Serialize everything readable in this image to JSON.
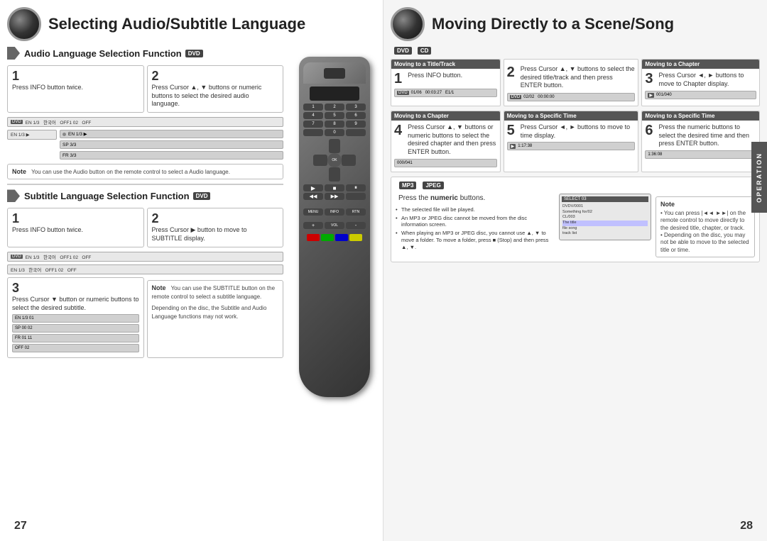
{
  "left": {
    "title": "Selecting Audio/Subtitle Language",
    "audio_section": {
      "label": "Audio Language Selection Function",
      "badge": "DVD",
      "step1": {
        "num": "1",
        "text": "Press INFO button twice."
      },
      "step2": {
        "num": "2",
        "text": "Press Cursor ▲, ▼ buttons or numeric buttons to select the desired audio language."
      },
      "note": "You can use the Audio button on the remote control to select a Audio language.",
      "screens": {
        "row1": "DVD  EN 1/3  한국어  OFF1 02  OFF",
        "row2a": "EN 1/3 ▶",
        "row2b": "SP 3/3",
        "row2c": "FR 3/3"
      }
    },
    "subtitle_section": {
      "label": "Subtitle Language Selection Function",
      "badge": "DVD",
      "step1": {
        "num": "1",
        "text": "Press INFO button twice."
      },
      "step2": {
        "num": "2",
        "text": "Press Cursor ▶ button to move to SUBTITLE display."
      },
      "step3": {
        "num": "3",
        "text": "Press Cursor ▼ button or numeric buttons to select the desired subtitle."
      },
      "note1": "You can use the SUBTITLE button on the remote control to select a subtitle language.",
      "note2": "Depending on the disc, the Subtitle and Audio Language functions may not work.",
      "screens": {
        "row1": "DVD  EN 1/3  한국어  OFF1 02  OFF",
        "row2": "EN 1/3  한국어  OFF1 02  OFF",
        "row3a": "EN 1/3  01",
        "row3b": "SP 00 02",
        "row3c": "FR 01 11",
        "row3d": "OFF  02"
      }
    }
  },
  "right": {
    "title": "Moving Directly to a Scene/Song",
    "badges": [
      "DVD",
      "CD"
    ],
    "section_title_track": "Moving to a Title/Track",
    "section_title_chapter": "Moving to a Chapter",
    "step1": {
      "num": "1",
      "text": "Press INFO button."
    },
    "step2": {
      "num": "2",
      "text": "Press Cursor ▲, ▼ buttons to select the desired title/track and then press ENTER button."
    },
    "step3": {
      "num": "3",
      "text": "Press Cursor ◄, ► buttons to move to Chapter display."
    },
    "section_chapter2": "Moving to a Chapter",
    "section_specific1": "Moving to a Specific Time",
    "section_specific2": "Moving to a Specific Time",
    "step4": {
      "num": "4",
      "text": "Press Cursor ▲, ▼ buttons or numeric buttons to select the desired chapter and then press ENTER button."
    },
    "step5": {
      "num": "5",
      "text": "Press Cursor ◄, ► buttons to move to time display."
    },
    "step6": {
      "num": "6",
      "text": "Press the numeric buttons to select the desired time and then press ENTER button."
    },
    "mp3_badges": [
      "MP3",
      "JPEG"
    ],
    "mp3_step": {
      "text": "Press the numeric buttons."
    },
    "bullet1": "The selected file will be played.",
    "bullet2": "An MP3 or JPEG disc cannot be moved from the disc information screen.",
    "bullet3": "When playing an MP3 or JPEG disc, you cannot use ▲, ▼ to move a folder. To move a folder, press ■ (Stop) and then press ▲, ▼.",
    "operation_label": "OPERATION",
    "note_right": "• You can press |◄◄ ►►| on the remote control to move directly to the desired title, chapter, or track.\n• Depending on the disc, you may not be able to move to the selected title or time.",
    "page_left": "27",
    "page_right": "28"
  }
}
